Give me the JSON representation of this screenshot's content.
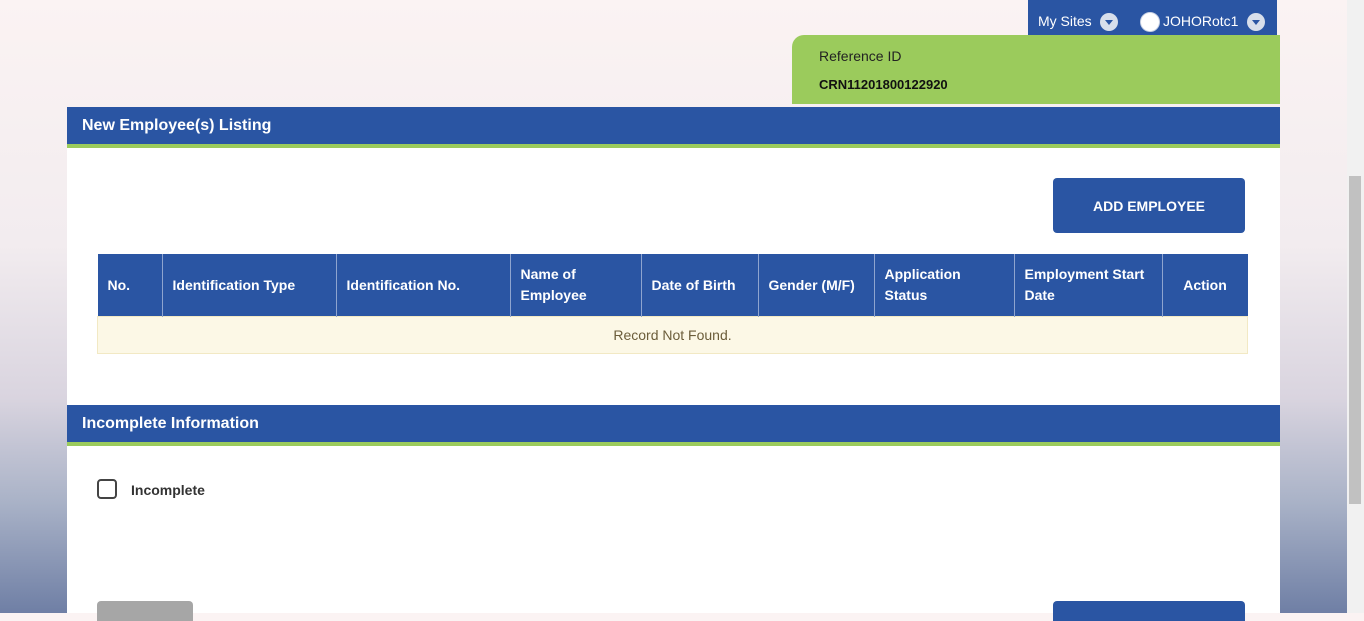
{
  "header": {
    "my_sites": "My Sites",
    "username": "JOHORotc1"
  },
  "reference": {
    "label": "Reference ID",
    "value": "CRN11201800122920"
  },
  "listing": {
    "title": "New Employee(s) Listing",
    "add_button": "ADD EMPLOYEE",
    "columns": [
      "No.",
      "Identification Type",
      "Identification No.",
      "Name of Employee",
      "Date of Birth",
      "Gender (M/F)",
      "Application Status",
      "Employment Start Date",
      "Action"
    ],
    "empty_message": "Record Not Found."
  },
  "incomplete": {
    "title": "Incomplete Information",
    "checkbox_label": "Incomplete",
    "checked": false
  },
  "colors": {
    "primary": "#2a55a3",
    "accent": "#9bcb5c",
    "empty_row_bg": "#fcf8e6"
  }
}
